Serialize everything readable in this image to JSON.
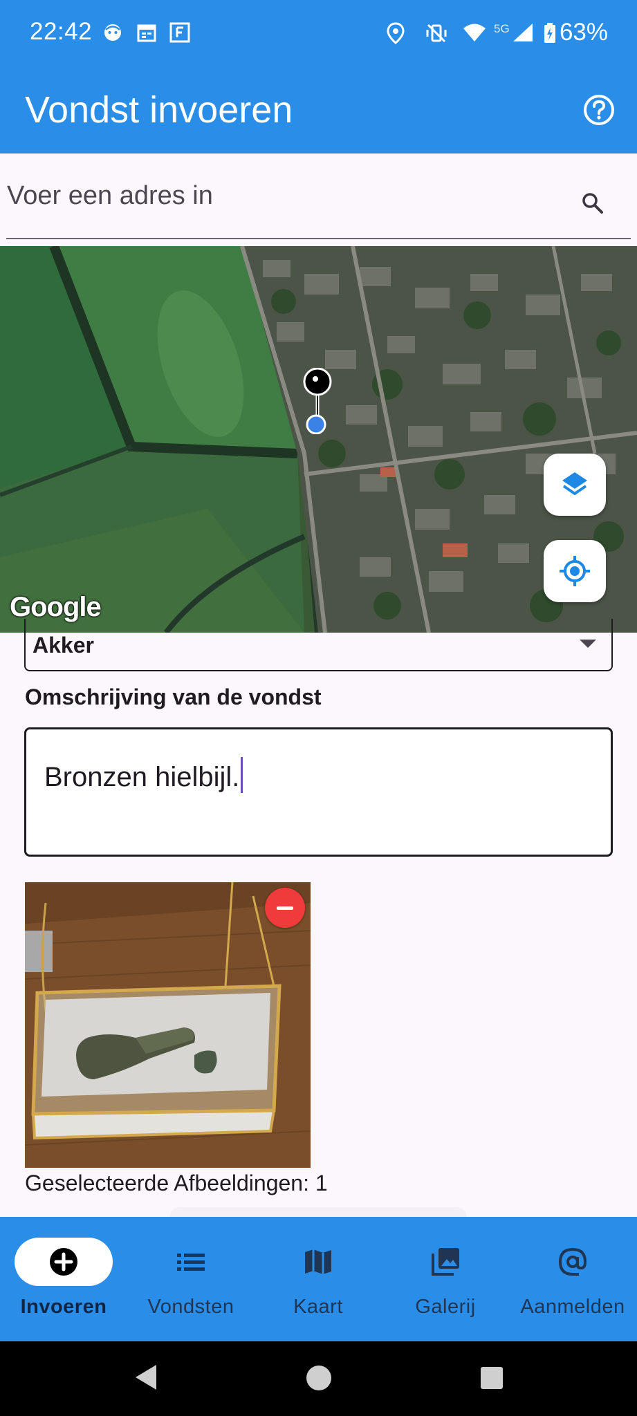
{
  "status_bar": {
    "time": "22:42",
    "network": "5G",
    "battery": "63%",
    "icons": [
      "face-notification-icon",
      "calendar-icon",
      "f-app-icon",
      "location-icon",
      "vibrate-off-icon",
      "wifi-icon",
      "signal-icon",
      "battery-charging-icon"
    ]
  },
  "app_bar": {
    "title": "Vondst invoeren",
    "help_icon": "help-circle-icon"
  },
  "search": {
    "placeholder": "Voer een adres in",
    "icon": "search-icon"
  },
  "map": {
    "attribution": "Google",
    "layers_icon": "layers-icon",
    "locate_icon": "my-location-icon"
  },
  "form": {
    "location_type": "Akker",
    "description_label": "Omschrijving van de vondst",
    "description_value": "Bronzen hielbijl.",
    "selected_images": "Geselecteerde Afbeeldingen: 1"
  },
  "bottom_nav": {
    "items": [
      {
        "label": "Invoeren",
        "icon": "add-circle-icon",
        "active": true
      },
      {
        "label": "Vondsten",
        "icon": "list-icon",
        "active": false
      },
      {
        "label": "Kaart",
        "icon": "map-icon",
        "active": false
      },
      {
        "label": "Galerij",
        "icon": "gallery-icon",
        "active": false
      },
      {
        "label": "Aanmelden",
        "icon": "at-sign-icon",
        "active": false
      }
    ]
  },
  "colors": {
    "primary": "#2a8de8",
    "background": "#fcf6fd",
    "remove": "#ef3b3b",
    "caret": "#6a4fb4"
  }
}
